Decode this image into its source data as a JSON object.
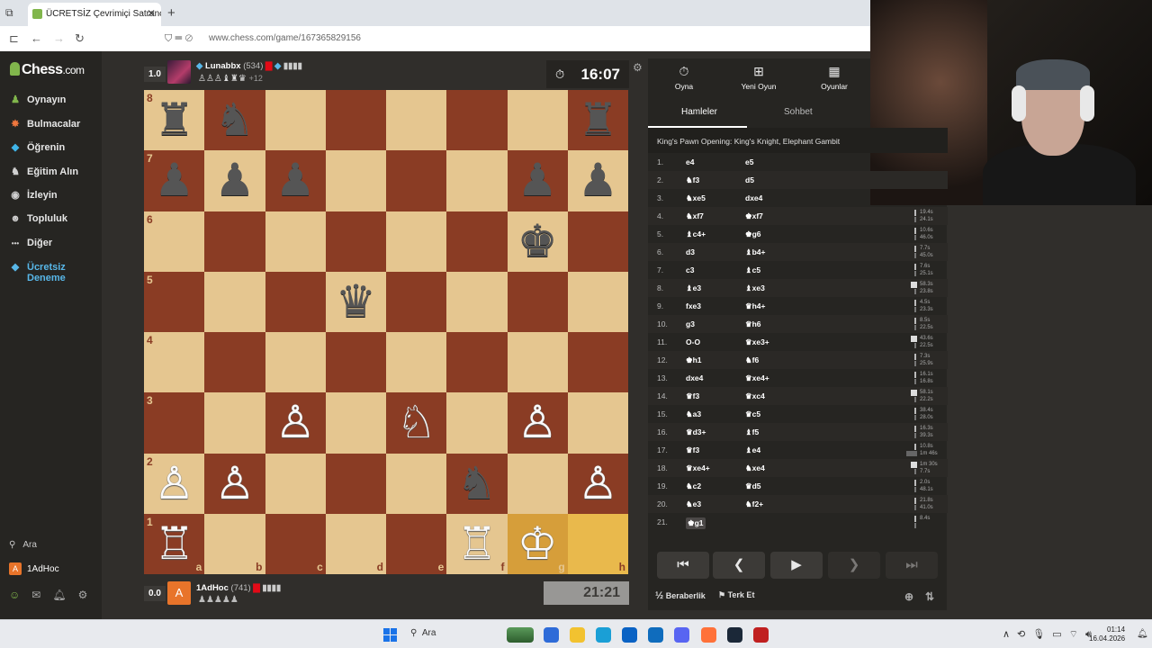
{
  "browser": {
    "tab_title": "ÜCRETSİZ Çevrimiçi Satranç Oy",
    "url": "www.chess.com/game/167365829156"
  },
  "sidebar": {
    "logo": "Chess",
    "logo_suffix": ".com",
    "items": [
      {
        "label": "Oynayın",
        "icon": "play-icon",
        "glyph": "♟",
        "color": "#81b64c"
      },
      {
        "label": "Bulmacalar",
        "icon": "puzzle-icon",
        "glyph": "✸",
        "color": "#f0773e"
      },
      {
        "label": "Öğrenin",
        "icon": "learn-icon",
        "glyph": "◆",
        "color": "#3fb4e8"
      },
      {
        "label": "Eğitim Alın",
        "icon": "coach-icon",
        "glyph": "♞",
        "color": "#d0d0d0"
      },
      {
        "label": "İzleyin",
        "icon": "watch-icon",
        "glyph": "◉",
        "color": "#d0d0d0"
      },
      {
        "label": "Topluluk",
        "icon": "community-icon",
        "glyph": "☻",
        "color": "#d0d0d0"
      },
      {
        "label": "Diğer",
        "icon": "more-icon",
        "glyph": "•••",
        "color": "#d0d0d0"
      }
    ],
    "promo_line1": "Ücretsiz",
    "promo_line2": "Deneme",
    "search_label": "Ara",
    "user_label": "1AdHoc",
    "user_initial": "A"
  },
  "top_player": {
    "score": "1.0",
    "name": "Lunabbx",
    "rating": "(534)",
    "captured": "♙♙♙♝♜♛",
    "advantage": "+12",
    "clock": "16:07"
  },
  "bottom_player": {
    "score": "0.0",
    "initial": "A",
    "name": "1AdHoc",
    "rating": "(741)",
    "captured": "♟♟♟♟♟",
    "clock": "21:21"
  },
  "board": {
    "files": [
      "a",
      "b",
      "c",
      "d",
      "e",
      "f",
      "g",
      "h"
    ],
    "ranks": [
      "8",
      "7",
      "6",
      "5",
      "4",
      "3",
      "2",
      "1"
    ],
    "light_color": "#e5c690",
    "dark_color": "#8a3c24",
    "highlight": [
      "g1",
      "h1"
    ],
    "pieces": [
      {
        "sq": "a8",
        "p": "♜",
        "c": "b"
      },
      {
        "sq": "b8",
        "p": "♞",
        "c": "b"
      },
      {
        "sq": "h8",
        "p": "♜",
        "c": "b"
      },
      {
        "sq": "a7",
        "p": "♟",
        "c": "b"
      },
      {
        "sq": "b7",
        "p": "♟",
        "c": "b"
      },
      {
        "sq": "c7",
        "p": "♟",
        "c": "b"
      },
      {
        "sq": "g7",
        "p": "♟",
        "c": "b"
      },
      {
        "sq": "h7",
        "p": "♟",
        "c": "b"
      },
      {
        "sq": "g6",
        "p": "♚",
        "c": "b"
      },
      {
        "sq": "d5",
        "p": "♛",
        "c": "b"
      },
      {
        "sq": "c3",
        "p": "♙",
        "c": "w"
      },
      {
        "sq": "e3",
        "p": "♘",
        "c": "w"
      },
      {
        "sq": "g3",
        "p": "♙",
        "c": "w"
      },
      {
        "sq": "a2",
        "p": "♙",
        "c": "w"
      },
      {
        "sq": "b2",
        "p": "♙",
        "c": "w"
      },
      {
        "sq": "f2",
        "p": "♞",
        "c": "b"
      },
      {
        "sq": "h2",
        "p": "♙",
        "c": "w"
      },
      {
        "sq": "a1",
        "p": "♖",
        "c": "w"
      },
      {
        "sq": "f1",
        "p": "♖",
        "c": "w"
      },
      {
        "sq": "g1",
        "p": "♔",
        "c": "w"
      }
    ]
  },
  "panel": {
    "actions": [
      {
        "label": "Oyna",
        "glyph": "⏱",
        "icon": "stopwatch-icon"
      },
      {
        "label": "Yeni Oyun",
        "glyph": "⊞",
        "icon": "new-game-icon"
      },
      {
        "label": "Oyunlar",
        "glyph": "▦",
        "icon": "games-icon"
      }
    ],
    "tab_moves": "Hamleler",
    "tab_chat": "Sohbet",
    "opening": "King's Pawn Opening: King's Knight, Elephant Gambit",
    "moves": [
      {
        "n": "1.",
        "w": "e4",
        "b": "e5",
        "tw": "",
        "tb": ""
      },
      {
        "n": "2.",
        "w": "♞f3",
        "b": "d5",
        "tw": "",
        "tb": ""
      },
      {
        "n": "3.",
        "w": "♞xe5",
        "b": "dxe4",
        "tw": "",
        "tb": ""
      },
      {
        "n": "4.",
        "w": "♞xf7",
        "b": "♚xf7",
        "tw": "19.4s",
        "tb": "24.1s"
      },
      {
        "n": "5.",
        "w": "♝c4+",
        "b": "♚g6",
        "tw": "10.6s",
        "tb": "46.0s"
      },
      {
        "n": "6.",
        "w": "d3",
        "b": "♝b4+",
        "tw": "7.7s",
        "tb": "45.0s"
      },
      {
        "n": "7.",
        "w": "c3",
        "b": "♝c5",
        "tw": "7.6s",
        "tb": "25.1s"
      },
      {
        "n": "8.",
        "w": "♝e3",
        "b": "♝xe3",
        "tw": "58.3s",
        "tb": "23.8s"
      },
      {
        "n": "9.",
        "w": "fxe3",
        "b": "♛h4+",
        "tw": "4.5s",
        "tb": "23.3s"
      },
      {
        "n": "10.",
        "w": "g3",
        "b": "♛h6",
        "tw": "8.5s",
        "tb": "22.5s"
      },
      {
        "n": "11.",
        "w": "O-O",
        "b": "♛xe3+",
        "tw": "43.6s",
        "tb": "22.5s"
      },
      {
        "n": "12.",
        "w": "♚h1",
        "b": "♞f6",
        "tw": "7.3s",
        "tb": "25.9s"
      },
      {
        "n": "13.",
        "w": "dxe4",
        "b": "♛xe4+",
        "tw": "16.1s",
        "tb": "16.8s"
      },
      {
        "n": "14.",
        "w": "♛f3",
        "b": "♛xc4",
        "tw": "58.1s",
        "tb": "22.2s"
      },
      {
        "n": "15.",
        "w": "♞a3",
        "b": "♛c5",
        "tw": "38.4s",
        "tb": "28.0s"
      },
      {
        "n": "16.",
        "w": "♛d3+",
        "b": "♝f5",
        "tw": "16.3s",
        "tb": "39.3s"
      },
      {
        "n": "17.",
        "w": "♛f3",
        "b": "♝e4",
        "tw": "10.8s",
        "tb": "1m 46s"
      },
      {
        "n": "18.",
        "w": "♛xe4+",
        "b": "♞xe4",
        "tw": "1m 30s",
        "tb": "7.7s"
      },
      {
        "n": "19.",
        "w": "♞c2",
        "b": "♛d5",
        "tw": "2.0s",
        "tb": "48.1s"
      },
      {
        "n": "20.",
        "w": "♞e3",
        "b": "♞f2+",
        "tw": "21.8s",
        "tb": "41.0s"
      },
      {
        "n": "21.",
        "w": "♚g1",
        "b": "",
        "tw": "8.4s",
        "tb": ""
      }
    ],
    "draw_label": "Beraberlik",
    "draw_glyph": "½",
    "resign_label": "Terk Et"
  },
  "taskbar": {
    "search": "Ara",
    "time": "01:14",
    "date": "16.04.2026",
    "apps": [
      {
        "name": "trees-widget",
        "color": "#3d7a3d"
      },
      {
        "name": "store-app",
        "color": "#2e6bd8"
      },
      {
        "name": "file-explorer",
        "color": "#f2c230"
      },
      {
        "name": "edge-browser",
        "color": "#1a9fd6"
      },
      {
        "name": "app-store",
        "color": "#0a62c4"
      },
      {
        "name": "outlook",
        "color": "#0f6cbd"
      },
      {
        "name": "discord",
        "color": "#5865f2"
      },
      {
        "name": "firefox",
        "color": "#ff7139"
      },
      {
        "name": "steam",
        "color": "#1b2838"
      },
      {
        "name": "chess-app",
        "color": "#c02020"
      }
    ]
  }
}
